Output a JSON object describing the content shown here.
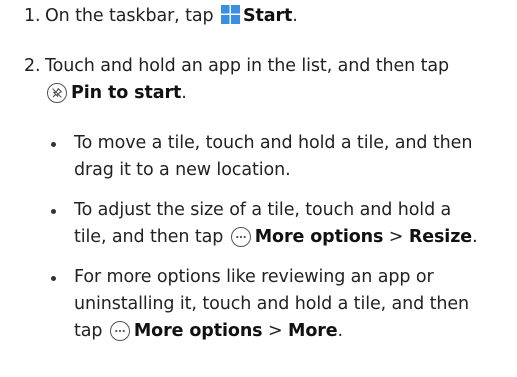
{
  "steps": [
    {
      "number": "1.",
      "prefix": "On the taskbar, tap ",
      "icon": "windows-start-icon",
      "bold": "Start",
      "suffix": "."
    },
    {
      "number": "2.",
      "line1": "Touch and hold an app in the list, and then tap",
      "icon": "pin-icon",
      "bold": "Pin to start",
      "suffix": "."
    }
  ],
  "bullets": [
    {
      "line1": "To move a tile, touch and hold a tile, and then",
      "line2": "drag it to a new location."
    },
    {
      "line1": "To adjust the size of a tile, touch and hold a",
      "line2_prefix": "tile, and then tap ",
      "icon": "more-options-icon",
      "bold1": "More options",
      "sep": " > ",
      "bold2": "Resize",
      "suffix": "."
    },
    {
      "line1": "For more options like reviewing an app or",
      "line2": "uninstalling it, touch and hold a tile, and then",
      "line3_prefix": "tap ",
      "icon": "more-options-icon",
      "bold1": "More options",
      "sep": " > ",
      "bold2": "More",
      "suffix": "."
    }
  ],
  "colors": {
    "text": "#222222",
    "icon_blue": "#3a8fe0"
  }
}
